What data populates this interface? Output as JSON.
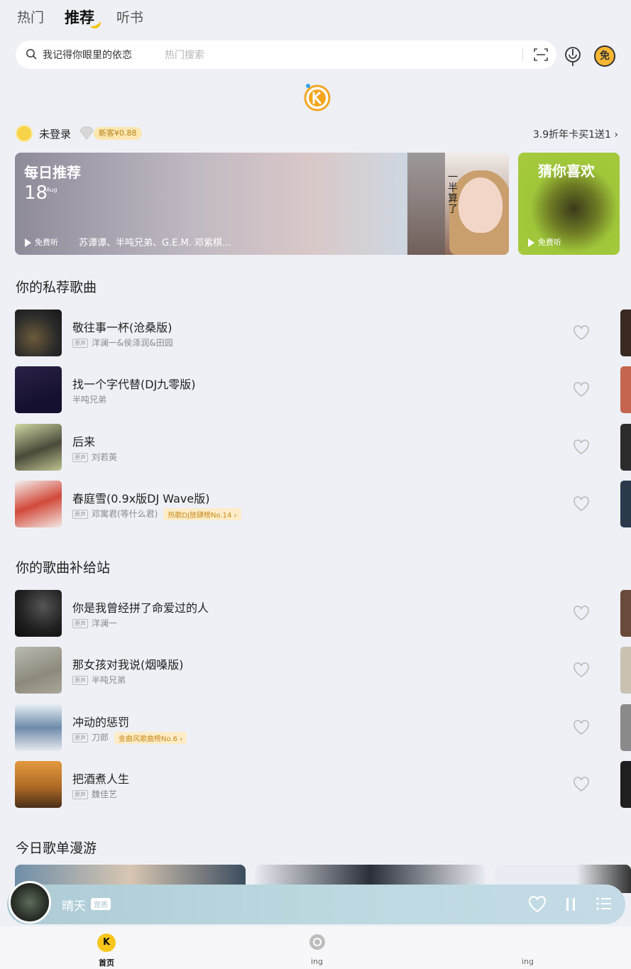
{
  "tabs": [
    {
      "label": "热门"
    },
    {
      "label": "推荐"
    },
    {
      "label": "听书"
    }
  ],
  "search": {
    "query": "我记得你眼里的依恋",
    "hint": "热门搜索"
  },
  "free_badge": "免",
  "login": {
    "status": "未登录",
    "vip_tag": "新客¥0.88",
    "promo": "3.9折年卡买1送1"
  },
  "banner_daily": {
    "title": "每日推荐",
    "day": "18",
    "month": "Aug",
    "play_label": "免费听",
    "artists": "苏谭谭、半吨兄弟、G.E.M. 邓紫棋...",
    "cover_title": "一半算了"
  },
  "banner_guess": {
    "title": "猜你喜欢",
    "play_label": "免费听"
  },
  "section_private": {
    "title": "你的私荐歌曲",
    "songs": [
      {
        "title": "敬往事一杯(沧桑版)",
        "quality": "原声",
        "artist": "洋澜一&侯泽润&田园",
        "chart": ""
      },
      {
        "title": "找一个字代替(DJ九零版)",
        "quality": "",
        "artist": "半吨兄弟",
        "chart": ""
      },
      {
        "title": "后来",
        "quality": "原声",
        "artist": "刘若英",
        "chart": ""
      },
      {
        "title": "春庭雪(0.9x版DJ Wave版)",
        "quality": "原声",
        "artist": "邓寓君(等什么君)",
        "chart": "热歌DJ放肆榜No.14"
      }
    ]
  },
  "section_supply": {
    "title": "你的歌曲补给站",
    "songs": [
      {
        "title": "你是我曾经拼了命爱过的人",
        "quality": "原声",
        "artist": "洋澜一",
        "chart": ""
      },
      {
        "title": "那女孩对我说(烟嗓版)",
        "quality": "原声",
        "artist": "半吨兄弟",
        "chart": ""
      },
      {
        "title": "冲动的惩罚",
        "quality": "原声",
        "artist": "刀郎",
        "chart": "金曲风歌曲榜No.6"
      },
      {
        "title": "把酒煮人生",
        "quality": "原声",
        "artist": "魏佳艺",
        "chart": ""
      }
    ]
  },
  "section_playlist": {
    "title": "今日歌单漫游"
  },
  "player": {
    "title": "晴天",
    "tag": "音质"
  },
  "nav": {
    "home": "首页",
    "ing": "ing",
    "me": "ing"
  },
  "colors": {
    "accent": "#f9c61c",
    "background": "#eef0f6",
    "player": "#bcd8df"
  }
}
